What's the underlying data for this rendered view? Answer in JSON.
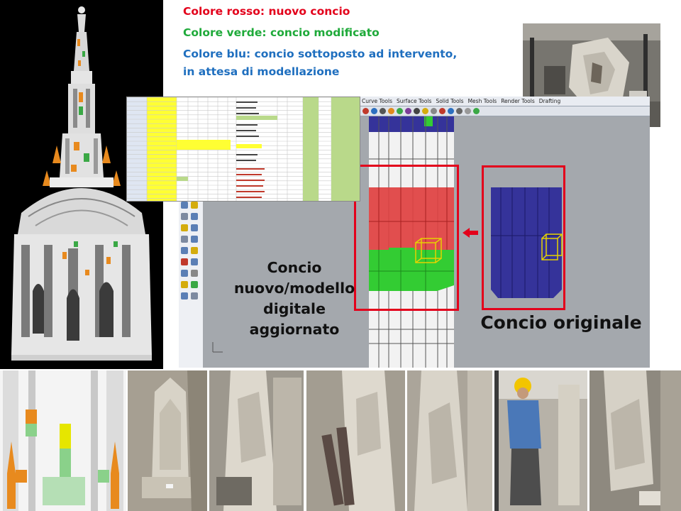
{
  "legend": {
    "red": "Colore rosso: nuovo concio",
    "green": "Colore verde: concio modificato",
    "blue_line1": "Colore blu: concio sottoposto ad intervento,",
    "blue_line2": "in attesa di modellazione"
  },
  "colors": {
    "red": "#e3001b",
    "green": "#1faa3a",
    "blue": "#1f6fbf",
    "new_block": "#e04040",
    "modified_block": "#33cc33",
    "original_block": "#35339a"
  },
  "cad": {
    "tabs": [
      "Curve Tools",
      "Surface Tools",
      "Solid Tools",
      "Mesh Tools",
      "Render Tools",
      "Drafting"
    ]
  },
  "labels": {
    "new_line1": "Concio",
    "new_line2": "nuovo/modello",
    "new_line3": "digitale",
    "new_line4": "aggiornato",
    "original": "Concio originale"
  },
  "icons": {
    "arrow": "arrow-left-icon"
  }
}
